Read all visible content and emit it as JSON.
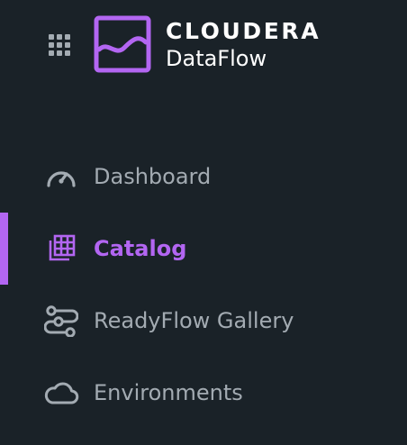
{
  "colors": {
    "background": "#1a2228",
    "accent": "#b366f2",
    "text_inactive": "#a3abb2",
    "text_header": "#ffffff"
  },
  "header": {
    "app_switcher_icon": "grid-icon",
    "logo_icon": "cloudera-wave-logo",
    "brand": "CLOUDERA",
    "product": "DataFlow"
  },
  "nav": {
    "items": [
      {
        "label": "Dashboard",
        "icon": "speedometer-icon",
        "active": false
      },
      {
        "label": "Catalog",
        "icon": "catalog-grid-icon",
        "active": true
      },
      {
        "label": "ReadyFlow Gallery",
        "icon": "readyflow-icon",
        "active": false
      },
      {
        "label": "Environments",
        "icon": "cloud-icon",
        "active": false
      }
    ]
  }
}
